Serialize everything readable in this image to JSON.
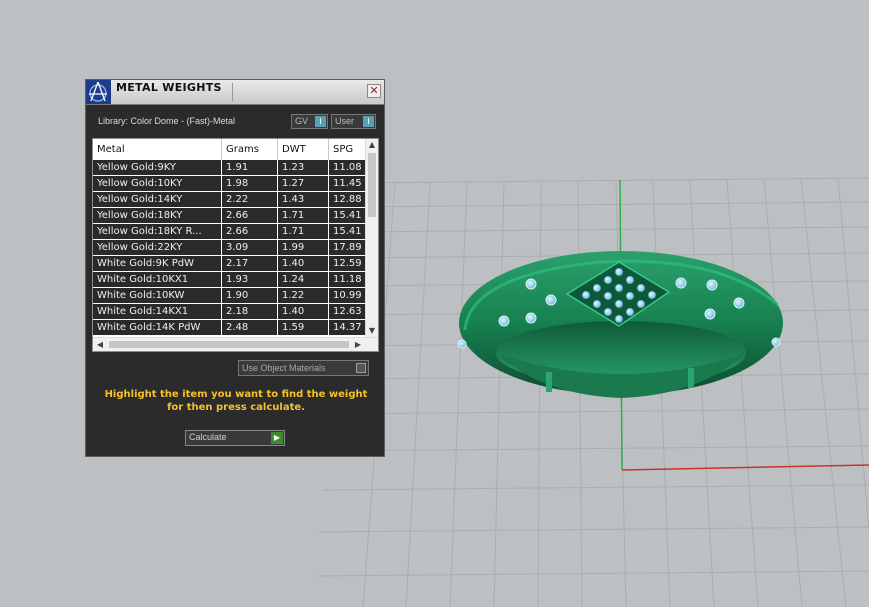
{
  "panel": {
    "title": "METAL WEIGHTS",
    "close_glyph": "✕",
    "library_label": "Library: Color Dome - (Fast)-Metal",
    "gv_toggle": "GV",
    "user_toggle": "User",
    "toggle_glyph": "I",
    "columns": [
      "Metal",
      "Grams",
      "DWT",
      "SPG"
    ],
    "rows": [
      [
        "Yellow Gold:9KY",
        "1.91",
        "1.23",
        "11.08"
      ],
      [
        "Yellow Gold:10KY",
        "1.98",
        "1.27",
        "11.45"
      ],
      [
        "Yellow Gold:14KY",
        "2.22",
        "1.43",
        "12.88"
      ],
      [
        "Yellow Gold:18KY",
        "2.66",
        "1.71",
        "15.41"
      ],
      [
        "Yellow Gold:18KY R...",
        "2.66",
        "1.71",
        "15.41"
      ],
      [
        "Yellow Gold:22KY",
        "3.09",
        "1.99",
        "17.89"
      ],
      [
        "White Gold:9K PdW",
        "2.17",
        "1.40",
        "12.59"
      ],
      [
        "White Gold:10KX1",
        "1.93",
        "1.24",
        "11.18"
      ],
      [
        "White Gold:10KW",
        "1.90",
        "1.22",
        "10.99"
      ],
      [
        "White Gold:14KX1",
        "2.18",
        "1.40",
        "12.63"
      ],
      [
        "White Gold:14K PdW",
        "2.48",
        "1.59",
        "14.37"
      ]
    ],
    "use_object_materials": "Use Object Materials",
    "instructions": "Highlight the item you want to find the weight for then press calculate.",
    "calculate_button": "Calculate",
    "calculate_glyph": "▶",
    "scroll_up": "▲",
    "scroll_down": "▼",
    "scroll_left": "◀",
    "scroll_right": "▶"
  },
  "icons": {
    "logo": "caliper-logo-icon",
    "close": "close-icon"
  },
  "colors": {
    "viewport_bg": "#bcc0c3",
    "grid_line": "#a9adb1",
    "ring_body": "#1f8c5c",
    "stone": "#8fd3ef",
    "axis_x": "#c8332d",
    "axis_y": "#2fb04a",
    "instructions_text": "#f6c12a",
    "toggle_switch": "#5aa0b4",
    "calc_go": "#3f8a2e"
  }
}
